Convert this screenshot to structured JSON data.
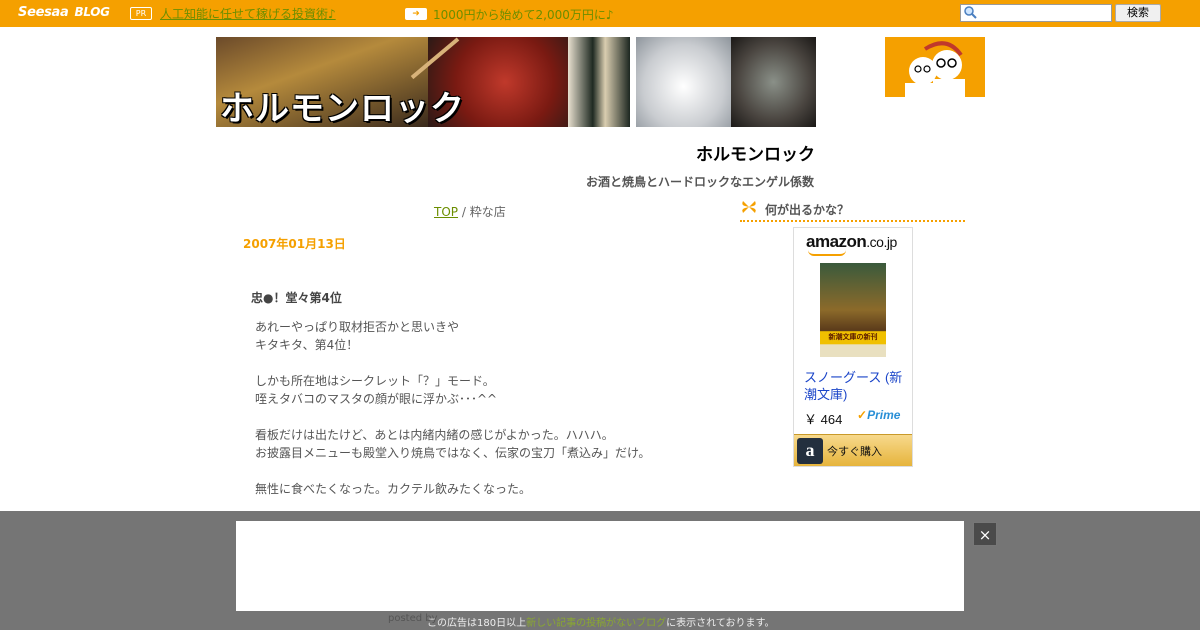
{
  "topbar": {
    "logo": "Seesaa",
    "logo_blog": "BLOG",
    "pr_badge": "PR",
    "pr_link": "人工知能に任せて稼げる投資術♪",
    "ad_link2": "1000円から始めて2,000万円に♪",
    "search_placeholder": "",
    "search_button": "検索",
    "accent_color": "#f5a000"
  },
  "banner": {
    "title_text": "ホルモンロック"
  },
  "blog": {
    "title": "ホルモンロック",
    "description": "お酒と焼鳥とハードロックなエンゲル係数"
  },
  "breadcrumb": {
    "top": "TOP",
    "separator": " / ",
    "current": "粋な店"
  },
  "post": {
    "date": "2007年01月13日",
    "title": "忠●！堂々第4位",
    "lines": [
      "あれーやっぱり取材拒否かと思いきや",
      "キタキタ、第4位！",
      "",
      "しかも所在地はシークレット「？」モード。",
      "咥えタバコのマスタの顔が眼に浮かぶ･･･^^",
      "",
      "看板だけは出たけど、あとは内緒内緒の感じがよかった。ハハハ。",
      "お披露目メニューも殿堂入り焼鳥ではなく、伝家の宝刀「煮込み」だけ。",
      "",
      "無性に食べたくなった。カクテル飲みたくなった。"
    ]
  },
  "sidebar": {
    "heading": "何が出るかな？",
    "amazon": {
      "logo": "amazon",
      "logo_suffix": ".co.jp",
      "cover_band": "新潮文庫の新刊",
      "product": "スノーグース (新潮文庫)",
      "price": "￥ 464",
      "prime": "Prime",
      "buy_a": "a",
      "buy_label": "今すぐ購入"
    }
  },
  "overlay": {
    "close": "×",
    "posted_by": "posted by",
    "notice_prefix": "この広告は180日以上",
    "notice_highlight": "新しい記事の投稿がないブログ",
    "notice_suffix": "に表示されております。"
  }
}
